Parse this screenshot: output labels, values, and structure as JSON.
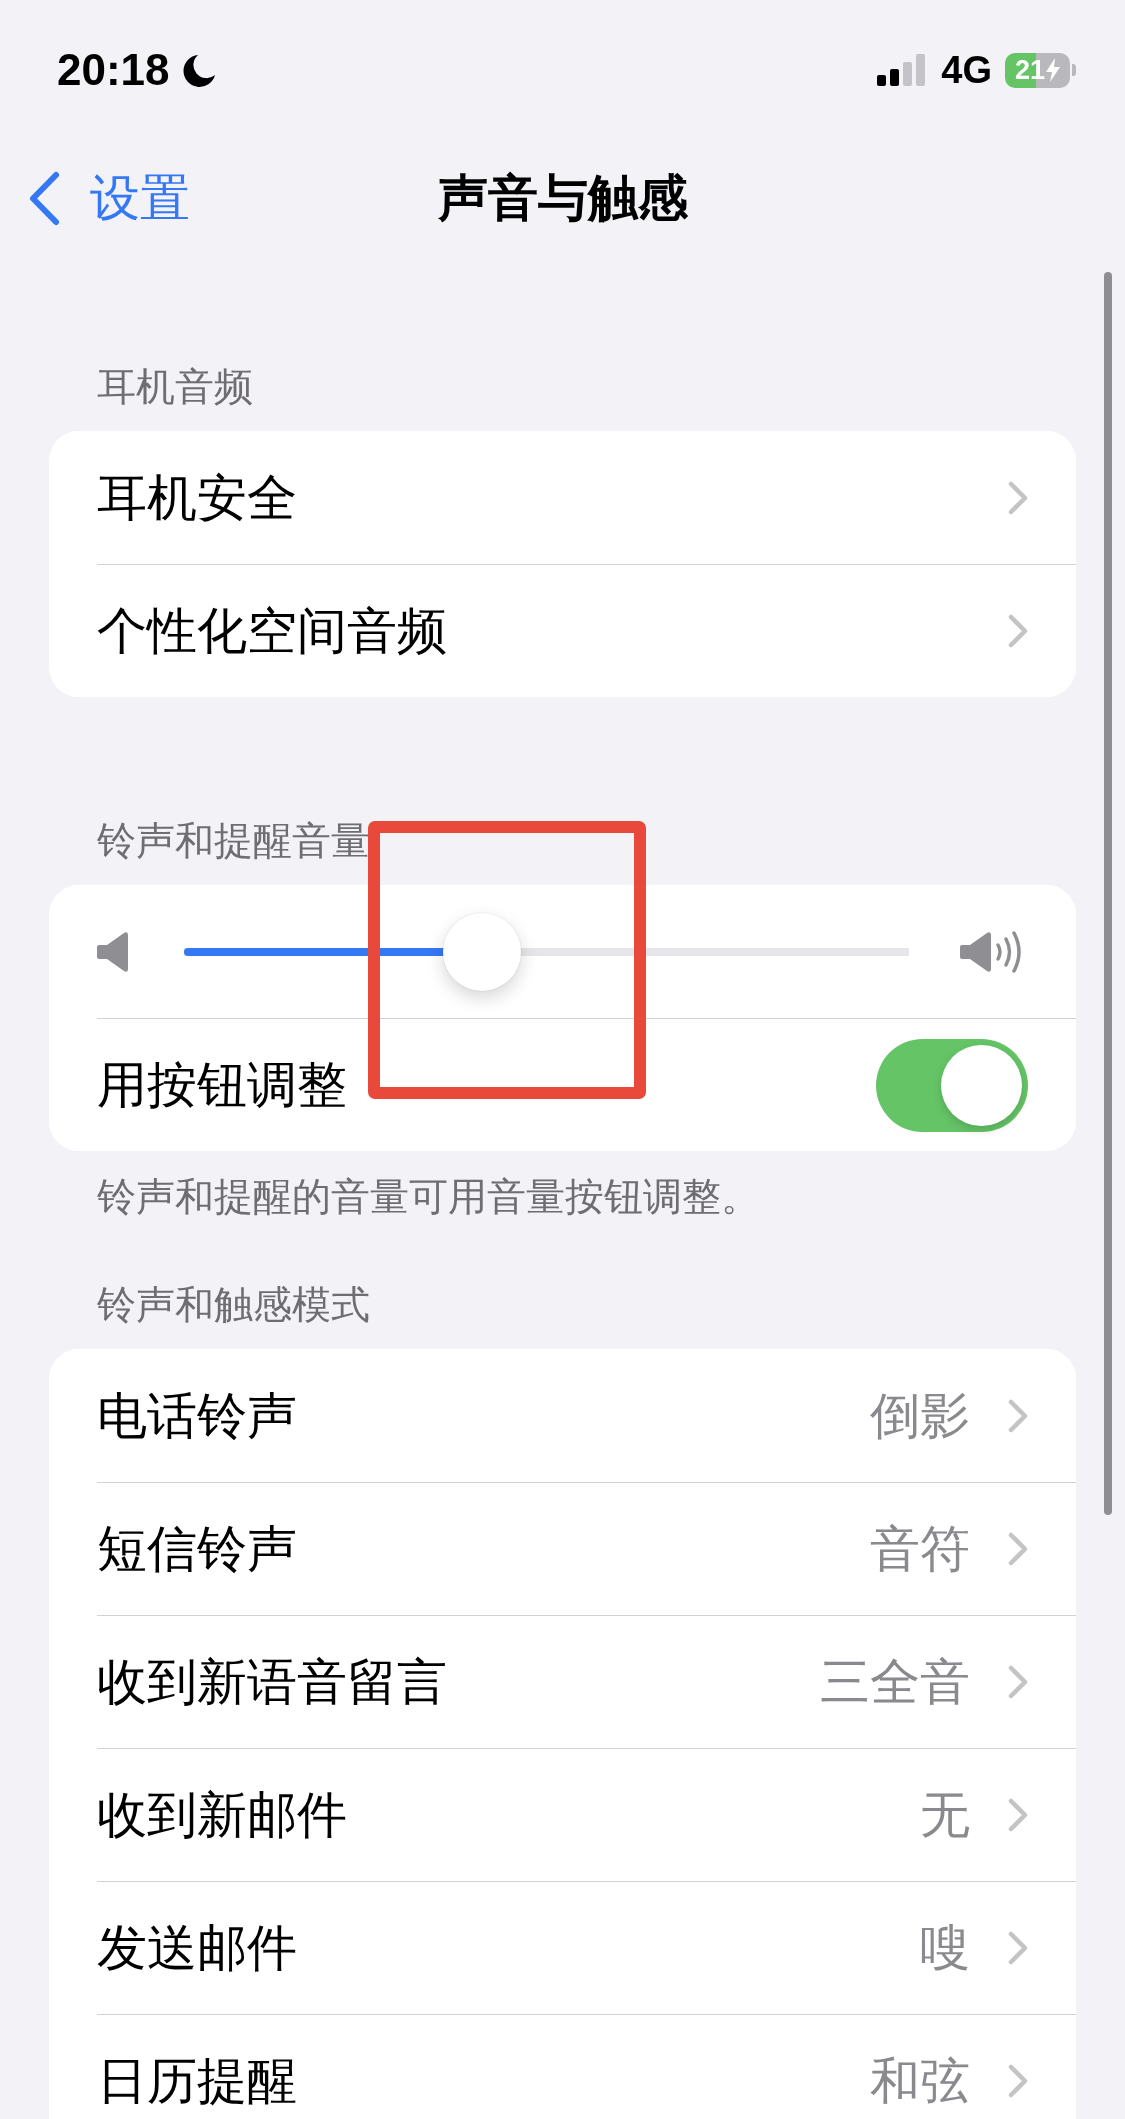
{
  "status_bar": {
    "time": "20:18",
    "focus_on": true,
    "network": "4G",
    "battery": {
      "percent": "21",
      "charging": true
    }
  },
  "nav_bar": {
    "back": "设置",
    "title": "声音与触感"
  },
  "sections": [
    {
      "header": "耳机音频",
      "rows": [
        {
          "kind": "link",
          "label": "耳机安全"
        },
        {
          "kind": "link",
          "label": "个性化空间音频"
        }
      ]
    },
    {
      "header": "铃声和提醒音量",
      "rows": [
        {
          "kind": "slider",
          "level": 0.4
        },
        {
          "kind": "switch",
          "label": "用按钮调整",
          "on": true
        }
      ],
      "footer": "铃声和提醒的音量可用音量按钮调整。"
    },
    {
      "header": "铃声和触感模式",
      "rows": [
        {
          "kind": "link",
          "label": "电话铃声",
          "value": "倒影"
        },
        {
          "kind": "link",
          "label": "短信铃声",
          "value": "音符"
        },
        {
          "kind": "link",
          "label": "收到新语音留言",
          "value": "三全音"
        },
        {
          "kind": "link",
          "label": "收到新邮件",
          "value": "无"
        },
        {
          "kind": "link",
          "label": "发送邮件",
          "value": "嗖"
        },
        {
          "kind": "link",
          "label": "日历提醒",
          "value": "和弦"
        }
      ]
    }
  ],
  "annotations": [
    {
      "kind": "rectangle"
    }
  ]
}
